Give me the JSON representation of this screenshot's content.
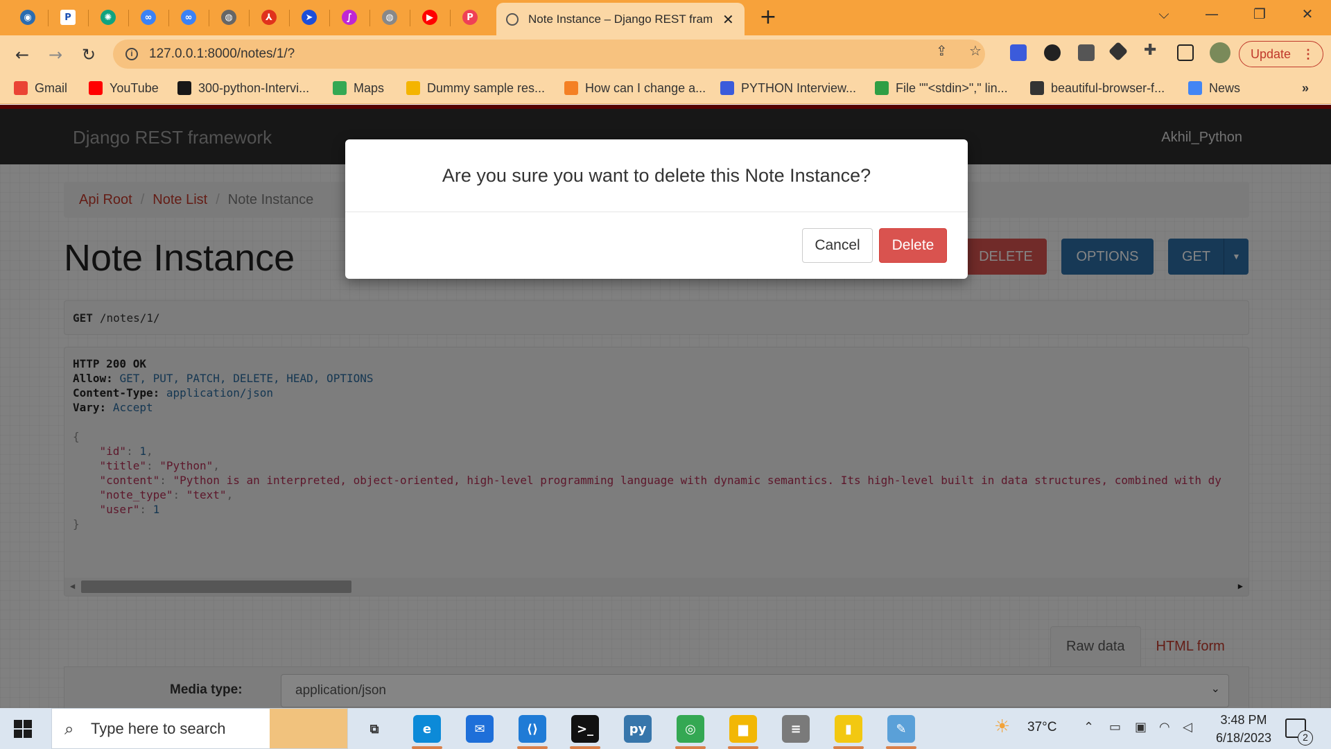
{
  "browser": {
    "pinned_tabs": [
      {
        "name": "firefox-tab-icon",
        "color": "#2b6cb0",
        "glyph": "◉"
      },
      {
        "name": "p-app-tab-icon",
        "color": "#ffffff",
        "glyph": "P"
      },
      {
        "name": "openai-tab-icon",
        "color": "#10a37f",
        "glyph": "✺"
      },
      {
        "name": "link-tab-icon",
        "color": "#3b82f6",
        "glyph": "∞"
      },
      {
        "name": "link2-tab-icon",
        "color": "#3b82f6",
        "glyph": "∞"
      },
      {
        "name": "globe-tab-icon",
        "color": "#666666",
        "glyph": "◍"
      },
      {
        "name": "pdf-tab-icon",
        "color": "#e0321c",
        "glyph": "⅄"
      },
      {
        "name": "arrow-tab-icon",
        "color": "#1d4ed8",
        "glyph": "➤"
      },
      {
        "name": "swirl-tab-icon",
        "color": "#c026d3",
        "glyph": "∫"
      },
      {
        "name": "globe2-tab-icon",
        "color": "#888888",
        "glyph": "◍"
      },
      {
        "name": "youtube-tab-icon",
        "color": "#ff0000",
        "glyph": "▶"
      },
      {
        "name": "pocket-tab-icon",
        "color": "#ef4056",
        "glyph": "P"
      }
    ],
    "active_tab_title": "Note Instance – Django REST framework",
    "url": "127.0.0.1:8000/notes/1/?",
    "update_label": "Update",
    "bookmarks": [
      {
        "label": "Gmail",
        "color": "#ea4335"
      },
      {
        "label": "YouTube",
        "color": "#ff0000"
      },
      {
        "label": "300-python-Intervi...",
        "color": "#181717"
      },
      {
        "label": "Maps",
        "color": "#34a853"
      },
      {
        "label": "Dummy sample res...",
        "color": "#f4b400"
      },
      {
        "label": "How can I change a...",
        "color": "#f48024"
      },
      {
        "label": "PYTHON Interview...",
        "color": "#3b5bdb"
      },
      {
        "label": "File \"\"<stdin>\",\" lin...",
        "color": "#2f9e44"
      },
      {
        "label": "beautiful-browser-f...",
        "color": "#333333"
      },
      {
        "label": "News",
        "color": "#4285f4"
      }
    ]
  },
  "app": {
    "brand": "Django REST framework",
    "user": "Akhil_Python",
    "breadcrumb": {
      "root": "Api Root",
      "list": "Note List",
      "current": "Note Instance"
    },
    "title": "Note Instance",
    "buttons": {
      "delete": "DELETE",
      "options": "OPTIONS",
      "get": "GET"
    },
    "request": {
      "method": "GET",
      "path": "/notes/1/"
    },
    "response": {
      "status": "HTTP 200 OK",
      "allow_label": "Allow:",
      "allow": "GET, PUT, PATCH, DELETE, HEAD, OPTIONS",
      "content_type_label": "Content-Type:",
      "content_type": "application/json",
      "vary_label": "Vary:",
      "vary": "Accept",
      "json": {
        "id": "1",
        "title": "\"Python\"",
        "content": "\"Python is an interpreted, object-oriented, high-level programming language with dynamic semantics. Its high-level built in data structures, combined with dy",
        "note_type": "\"text\"",
        "user": "1"
      }
    },
    "form_tabs": {
      "raw": "Raw data",
      "html": "HTML form"
    },
    "media_type_label": "Media type:",
    "media_type_value": "application/json"
  },
  "modal": {
    "question": "Are you sure you want to delete this Note Instance?",
    "cancel": "Cancel",
    "delete": "Delete"
  },
  "taskbar": {
    "search_placeholder": "Type here to search",
    "weather": "37°C",
    "time": "3:48 PM",
    "date": "6/18/2023",
    "notification_count": "2",
    "apps": [
      {
        "name": "task-view-icon",
        "color": "#333333",
        "glyph": "⧉"
      },
      {
        "name": "edge-icon",
        "color": "#0c8ad8",
        "glyph": "e"
      },
      {
        "name": "mail-icon",
        "color": "#1e6fd9",
        "glyph": "✉"
      },
      {
        "name": "vscode-icon",
        "color": "#1f7bd6",
        "glyph": "⟨⟩"
      },
      {
        "name": "terminal-icon",
        "color": "#111111",
        "glyph": ">_"
      },
      {
        "name": "python-file-icon",
        "color": "#3776ab",
        "glyph": "py"
      },
      {
        "name": "chrome-icon",
        "color": "#34a853",
        "glyph": "◎"
      },
      {
        "name": "file-explorer-icon",
        "color": "#f2b705",
        "glyph": "▆"
      },
      {
        "name": "database-icon",
        "color": "#7a7a7a",
        "glyph": "≡"
      },
      {
        "name": "powerbi-icon",
        "color": "#f2c811",
        "glyph": "▮"
      },
      {
        "name": "notepad-icon",
        "color": "#5aa0d8",
        "glyph": "✎"
      }
    ]
  }
}
